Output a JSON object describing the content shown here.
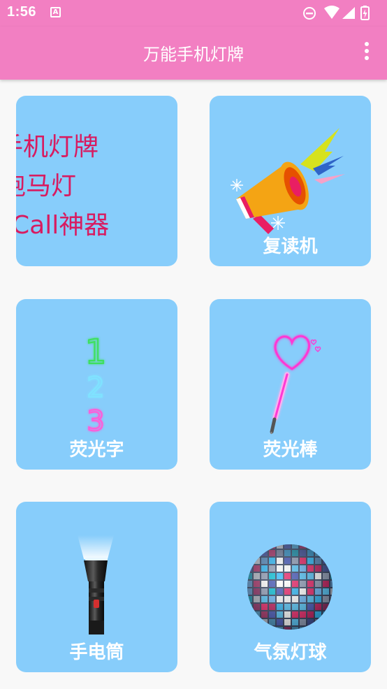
{
  "status_bar": {
    "time": "1:56",
    "notification_icon": "app-a-icon",
    "icons": [
      "do-not-disturb-icon",
      "wifi-icon",
      "signal-icon",
      "battery-charging-icon"
    ]
  },
  "app_bar": {
    "title": "万能手机灯牌",
    "menu_icon": "more-vert-icon"
  },
  "tiles": [
    {
      "id": "marquee",
      "lines": [
        "手机灯牌",
        "跑马灯",
        "Call神器"
      ],
      "icon": "marquee-text-preview"
    },
    {
      "id": "repeater",
      "label": "复读机",
      "icon": "megaphone-icon"
    },
    {
      "id": "neon-text",
      "label": "荧光字",
      "icon": "neon-numbers-icon",
      "digits": [
        "1",
        "2",
        "3"
      ]
    },
    {
      "id": "glow-stick",
      "label": "荧光棒",
      "icon": "heart-glow-stick-icon"
    },
    {
      "id": "flashlight",
      "label": "手电筒",
      "icon": "flashlight-icon"
    },
    {
      "id": "disco-ball",
      "label": "气氛灯球",
      "icon": "disco-ball-icon"
    }
  ],
  "colors": {
    "primary": "#f27fc2",
    "tile_background": "#87cdfb",
    "page_background": "#f8f8f8",
    "marquee_text": "#d81b60",
    "tile_label": "#ffffff"
  }
}
